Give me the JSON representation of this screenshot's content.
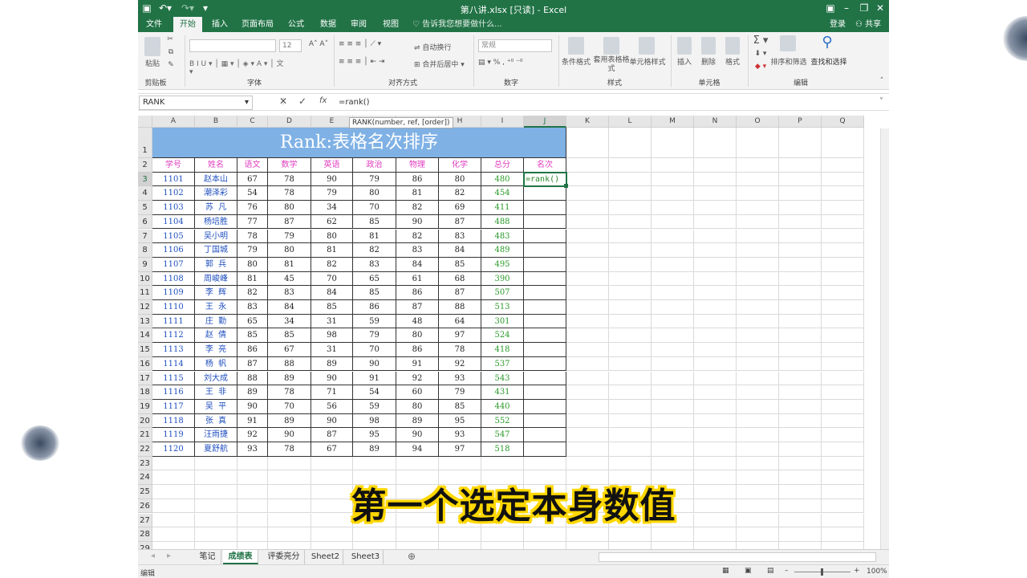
{
  "window": {
    "title": "第八讲.xlsx  [只读] - Excel"
  },
  "tabs": [
    "文件",
    "开始",
    "插入",
    "页面布局",
    "公式",
    "数据",
    "审阅",
    "视图"
  ],
  "tell_me": "告诉我您想要做什么...",
  "account": {
    "signin": "登录",
    "share": "共享"
  },
  "ribbon": {
    "clipboard": {
      "label": "剪贴板",
      "paste": "粘贴"
    },
    "font": {
      "label": "字体",
      "size": "12"
    },
    "alignment": {
      "label": "对齐方式",
      "wrap": "自动换行",
      "merge": "合并后居中"
    },
    "number": {
      "label": "数字",
      "format": "常规"
    },
    "styles": {
      "label": "样式",
      "conditional": "条件格式",
      "table": "套用表格格式",
      "cell_styles": "单元格样式"
    },
    "cells": {
      "label": "单元格",
      "insert": "插入",
      "delete": "删除",
      "format": "格式"
    },
    "editing": {
      "label": "编辑",
      "sort": "排序和筛选",
      "find": "查找和选择"
    }
  },
  "formula_bar": {
    "name_box": "RANK",
    "formula": "=rank()",
    "tooltip": "RANK(number, ref, [order])"
  },
  "columns": [
    "A",
    "B",
    "C",
    "D",
    "E",
    "F",
    "G",
    "H",
    "I",
    "J",
    "K",
    "L",
    "M",
    "N",
    "O",
    "P",
    "Q"
  ],
  "table": {
    "title": "Rank:表格名次排序",
    "headers": [
      "学号",
      "姓名",
      "语文",
      "数学",
      "英语",
      "政治",
      "物理",
      "化学",
      "总分",
      "名次"
    ],
    "rows": [
      [
        "1101",
        "赵本山",
        "67",
        "78",
        "90",
        "79",
        "86",
        "80",
        "480"
      ],
      [
        "1102",
        "潮泽彩",
        "54",
        "78",
        "79",
        "80",
        "81",
        "82",
        "454"
      ],
      [
        "1103",
        "苏  凡",
        "76",
        "80",
        "34",
        "70",
        "82",
        "69",
        "411"
      ],
      [
        "1104",
        "杨培胜",
        "77",
        "87",
        "62",
        "85",
        "90",
        "87",
        "488"
      ],
      [
        "1105",
        "吴小明",
        "78",
        "79",
        "80",
        "81",
        "82",
        "83",
        "483"
      ],
      [
        "1106",
        "丁国城",
        "79",
        "80",
        "81",
        "82",
        "83",
        "84",
        "489"
      ],
      [
        "1107",
        "郭  兵",
        "80",
        "81",
        "82",
        "83",
        "84",
        "85",
        "495"
      ],
      [
        "1108",
        "周峻峰",
        "81",
        "45",
        "70",
        "65",
        "61",
        "68",
        "390"
      ],
      [
        "1109",
        "李  辉",
        "82",
        "83",
        "84",
        "85",
        "86",
        "87",
        "507"
      ],
      [
        "1110",
        "王  永",
        "83",
        "84",
        "85",
        "86",
        "87",
        "88",
        "513"
      ],
      [
        "1111",
        "庄  勤",
        "65",
        "34",
        "31",
        "59",
        "48",
        "64",
        "301"
      ],
      [
        "1112",
        "赵  倩",
        "85",
        "85",
        "98",
        "79",
        "80",
        "97",
        "524"
      ],
      [
        "1113",
        "李  亮",
        "86",
        "67",
        "31",
        "70",
        "86",
        "78",
        "418"
      ],
      [
        "1114",
        "杨  帆",
        "87",
        "88",
        "89",
        "90",
        "91",
        "92",
        "537"
      ],
      [
        "1115",
        "刘大成",
        "88",
        "89",
        "90",
        "91",
        "92",
        "93",
        "543"
      ],
      [
        "1116",
        "王  非",
        "89",
        "78",
        "71",
        "54",
        "60",
        "79",
        "431"
      ],
      [
        "1117",
        "吴  平",
        "90",
        "70",
        "56",
        "59",
        "80",
        "85",
        "440"
      ],
      [
        "1118",
        "张  真",
        "91",
        "89",
        "90",
        "98",
        "89",
        "95",
        "552"
      ],
      [
        "1119",
        "汪雨捷",
        "92",
        "90",
        "87",
        "95",
        "90",
        "93",
        "547"
      ],
      [
        "1120",
        "夏舒航",
        "93",
        "78",
        "67",
        "89",
        "94",
        "97",
        "518"
      ]
    ],
    "active_cell_text": "=rank()"
  },
  "sheets": [
    "笔记",
    "成绩表",
    "评委亮分",
    "Sheet2",
    "Sheet3"
  ],
  "active_sheet": "成绩表",
  "status": {
    "mode": "编辑",
    "zoom": "100%"
  },
  "subtitle": "第一个选定本身数值",
  "colors": {
    "excel_green": "#217346",
    "header_pink": "#e040c0",
    "id_blue": "#1f4fbf",
    "total_green": "#2a9a2a",
    "title_band": "#7fb1e5"
  }
}
